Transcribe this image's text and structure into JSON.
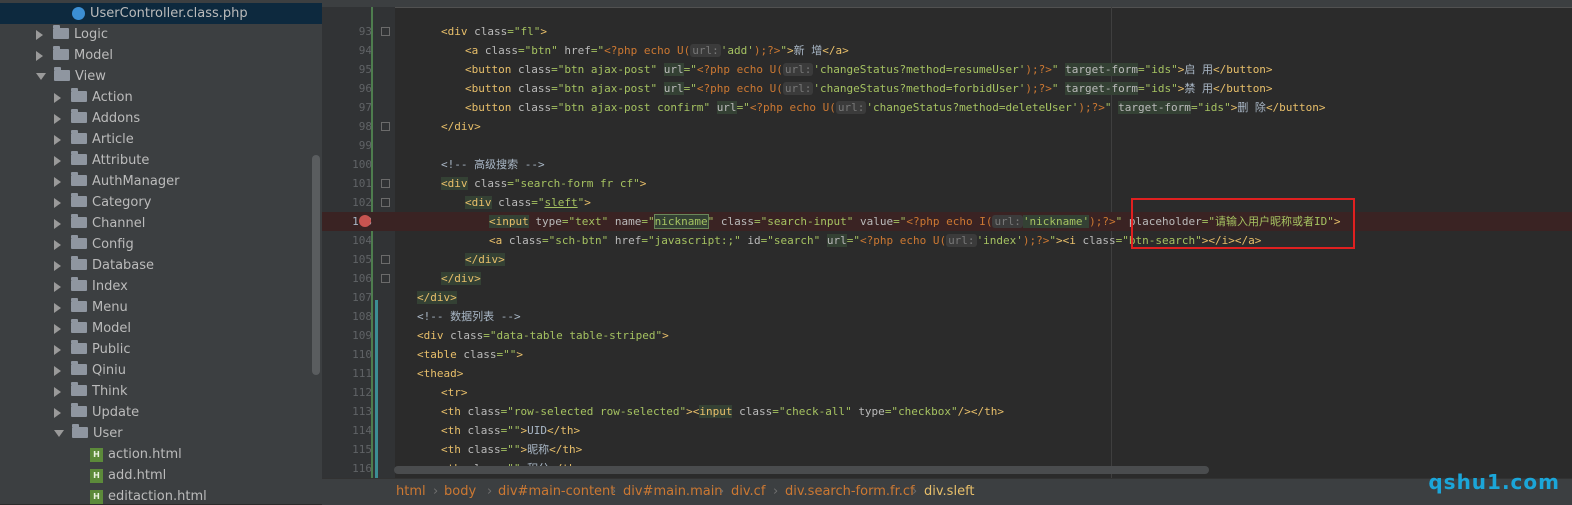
{
  "tree": {
    "selected_file": "UserController.class.php",
    "folders": [
      "Logic",
      "Model",
      "View",
      "Action",
      "Addons",
      "Article",
      "Attribute",
      "AuthManager",
      "Category",
      "Channel",
      "Config",
      "Database",
      "Index",
      "Menu",
      "Model",
      "Public",
      "Qiniu",
      "Think",
      "Update",
      "User"
    ],
    "files": [
      "action.html",
      "add.html",
      "editaction.html"
    ]
  },
  "editor": {
    "line_numbers": [
      "93",
      "94",
      "95",
      "96",
      "97",
      "98",
      "99",
      "100",
      "101",
      "102",
      "103",
      "104",
      "105",
      "106",
      "107",
      "108",
      "109",
      "110",
      "111",
      "112",
      "113",
      "114",
      "115",
      "116"
    ],
    "param_hint": "url:",
    "lines": {
      "l93": {
        "tag": "div",
        "attr": "class",
        "val": "fl"
      },
      "l94": {
        "a": "a",
        "cls_attr": "class",
        "cls_val": "btn",
        "href_attr": "href",
        "php": "<?php echo U(",
        "arg": "'add'",
        "close": ");?>",
        "text": "新 增",
        "end": "</a>"
      },
      "l95": {
        "tag": "button",
        "cls_val": "btn ajax-post",
        "url_attr": "url",
        "php": "<?php echo U(",
        "arg": "'changeStatus?method=resumeUser'",
        "close": ");?>",
        "tf_attr": "target-form",
        "tf_val": "ids",
        "text": "启 用",
        "end": "</button>"
      },
      "l96": {
        "cls_val": "btn ajax-post",
        "arg": "'changeStatus?method=forbidUser'",
        "text": "禁 用"
      },
      "l97": {
        "cls_val": "btn ajax-post confirm",
        "arg": "'changeStatus?method=deleteUser'",
        "text": "删 除"
      },
      "l98": {
        "end": "</div>"
      },
      "l100": {
        "comment": "<!-- 高级搜索 -->"
      },
      "l101": {
        "cls_val": "search-form fr cf"
      },
      "l102": {
        "cls_val": "sleft"
      },
      "l103": {
        "tag": "input",
        "type_val": "text",
        "name_val": "nickname",
        "cls_val": "search-input",
        "value_php": "<?php echo I(",
        "value_arg": "'nickname'",
        "value_close": ");?>",
        "placeholder_attr": "placeholder",
        "placeholder_val": "请输入用户昵称或者ID"
      },
      "l104": {
        "cls_val": "sch-btn",
        "href_val": "javascript:;",
        "id_val": "search",
        "arg": "'index'",
        "i_cls": "btn-search",
        "end": "</i></a>"
      },
      "l105": {
        "end": "</div>"
      },
      "l106": {
        "end": "</div>"
      },
      "l107": {
        "end": "</div>"
      },
      "l108": {
        "comment": "<!-- 数据列表 -->"
      },
      "l109": {
        "cls_val": "data-table table-striped"
      },
      "l110": {
        "cls_val": ""
      },
      "l111": {
        "tag": "thead"
      },
      "l112": {
        "tag": "tr"
      },
      "l113": {
        "cls_val": "row-selected row-selected",
        "input_cls": "check-all",
        "type_val": "checkbox"
      },
      "l114": {
        "text": "UID"
      },
      "l115": {
        "text": "昵称"
      },
      "l116": {
        "text": "积分"
      }
    }
  },
  "breadcrumb": [
    "html",
    "body",
    "div#main-content",
    "div#main.main",
    "div.cf",
    "div.search-form.fr.cf",
    "div.sleft"
  ],
  "watermark": "qshu1.com",
  "colors": {
    "tag": "#e8bf6a",
    "string": "#a5c261",
    "keyword": "#cc7832",
    "annotation": "#e02020"
  }
}
